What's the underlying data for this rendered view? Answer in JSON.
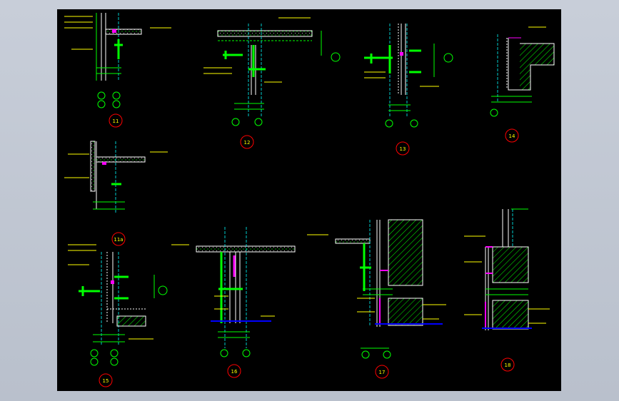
{
  "details": [
    {
      "id": "d11",
      "label": "11"
    },
    {
      "id": "d12",
      "label": "12"
    },
    {
      "id": "d13",
      "label": "13"
    },
    {
      "id": "d14",
      "label": "14"
    },
    {
      "id": "d11a",
      "label": "11a"
    },
    {
      "id": "d15",
      "label": "15"
    },
    {
      "id": "d16",
      "label": "16"
    },
    {
      "id": "d17",
      "label": "17"
    },
    {
      "id": "d18",
      "label": "18"
    }
  ],
  "colors": {
    "background": "#000000",
    "line": "#ffffff",
    "dimension": "#00ff00",
    "text": "#ffff00",
    "axis": "#00ffff",
    "callout": "#ff0000",
    "highlight": "#ff00ff",
    "ground": "#0000ff"
  }
}
